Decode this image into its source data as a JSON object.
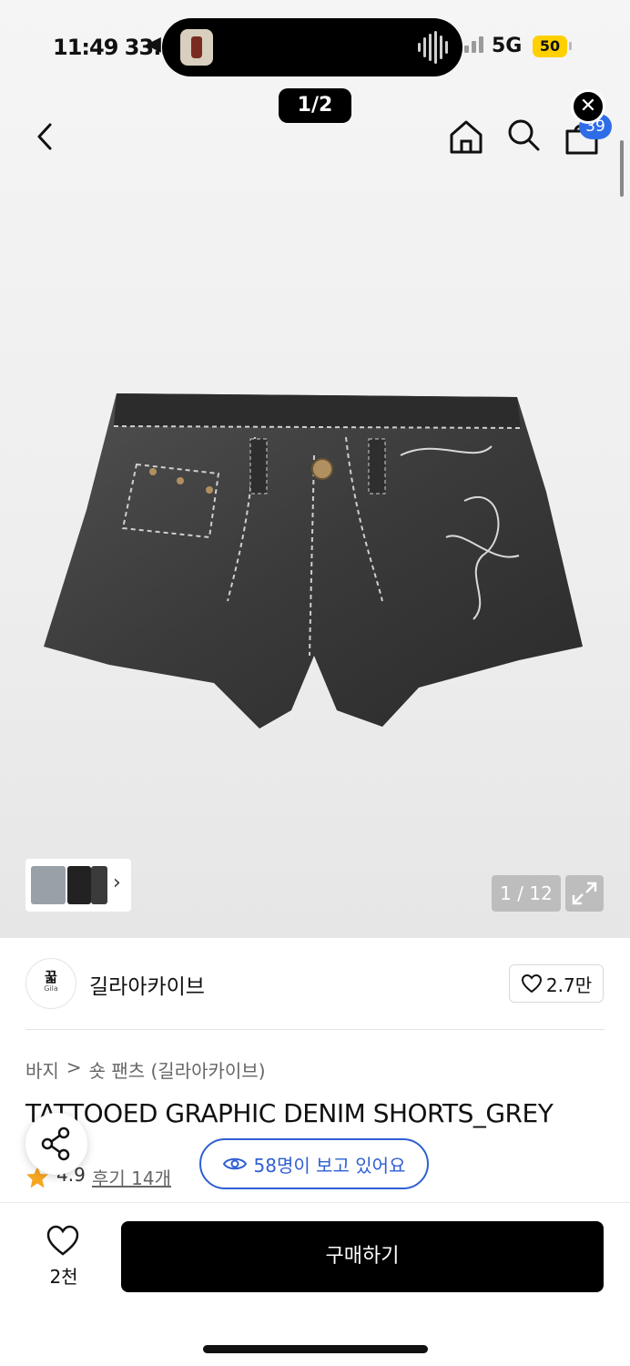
{
  "status_bar": {
    "time": "11:49 33:38",
    "arrow": "◀",
    "network": "5G",
    "battery": "50"
  },
  "pager": {
    "label": "1/2"
  },
  "header": {
    "cart_badge": "39",
    "close_label": "✕"
  },
  "gallery": {
    "counter": "1 / 12",
    "thumb_chevron": "›",
    "colors": {
      "shorts_main": "#3a3a3a",
      "shorts_dark": "#262626",
      "stitch": "#cfcfcf",
      "rivet": "#b09060"
    }
  },
  "brand": {
    "name": "길라아카이브",
    "logo_mark": "꿃",
    "logo_sub": "Gila",
    "like_count": "2.7만"
  },
  "breadcrumb": {
    "category": "바지",
    "separator": ">",
    "subcategory": "숏 팬츠 (길라아카이브)"
  },
  "product": {
    "title": "TATTOOED GRAPHIC DENIM SHORTS_GREY",
    "rating": "4.9",
    "reviews": "후기 14개",
    "viewers": "58명이 보고 있어요"
  },
  "bottom_bar": {
    "wish_count": "2천",
    "buy_label": "구매하기"
  },
  "colors": {
    "accent_blue": "#2f5fd3",
    "badge_blue": "#2f6de8",
    "star": "#f5a623",
    "battery": "#ffd000"
  }
}
